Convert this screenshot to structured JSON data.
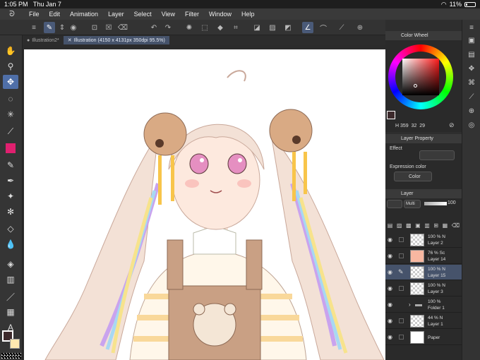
{
  "status": {
    "time": "1:05 PM",
    "date": "Thu Jan 7",
    "battery": "11%"
  },
  "menu": [
    "File",
    "Edit",
    "Animation",
    "Layer",
    "Select",
    "View",
    "Filter",
    "Window",
    "Help"
  ],
  "tabs": [
    {
      "label": "Illustration2*"
    },
    {
      "label": "Illustration (4150 x 4131px 350dpi 95.5%)"
    }
  ],
  "color_wheel": {
    "title": "Color Wheel",
    "h": "359",
    "s": "32",
    "v": "29",
    "main_color": "#3d2a2c",
    "sub_color": "#ffffff"
  },
  "layer_property": {
    "title": "Layer Property",
    "effect": "Effect",
    "expression_label": "Expression color",
    "expression_value": "Color"
  },
  "layer_panel": {
    "title": "Layer",
    "blend_mode": "Multi",
    "opacity": "100",
    "layers": [
      {
        "pct": "100 %",
        "mode": "N",
        "name": "Layer 2",
        "thumb": "transparent",
        "selected": false
      },
      {
        "pct": "76 %",
        "mode": "Sc",
        "name": "Layer 14",
        "thumb": "#f7b7a1",
        "selected": false
      },
      {
        "pct": "100 %",
        "mode": "N",
        "name": "Layer 15",
        "thumb": "transparent",
        "selected": true
      },
      {
        "pct": "100 %",
        "mode": "N",
        "name": "Layer 3",
        "thumb": "transparent",
        "selected": false
      },
      {
        "pct": "100 %",
        "mode": "",
        "name": "Folder 1",
        "thumb": "folder",
        "selected": false
      },
      {
        "pct": "44 %",
        "mode": "N",
        "name": "Layer 1",
        "thumb": "transparent",
        "selected": false
      },
      {
        "pct": "",
        "mode": "",
        "name": "Paper",
        "thumb": "#ffffff",
        "selected": false
      }
    ]
  },
  "colors": {
    "accent": "#4f6fa8",
    "selected_layer": "#46536b",
    "fg_swatch": "#3d2a2c",
    "bg_swatch": "#ffe8b0",
    "magenta_tool": "#e0206f"
  }
}
